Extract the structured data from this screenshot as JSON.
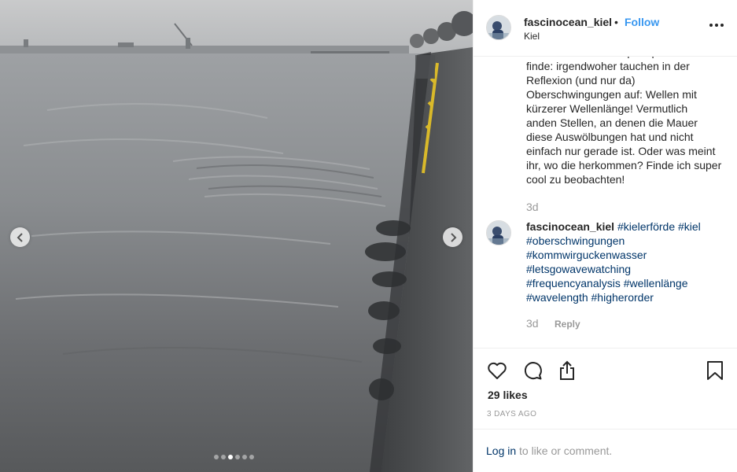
{
  "post": {
    "username": "fascinocean_kiel",
    "separator": "•",
    "follow_label": "Follow",
    "location": "Kiel"
  },
  "carousel": {
    "slide_count": 6,
    "active_index": 2
  },
  "caption": {
    "lines": [
      "wird. Und was ich super spannend",
      "finde: irgendwoher tauchen in der",
      "Reflexion (und nur da)",
      "Oberschwingungen auf: Wellen mit",
      "kürzerer Wellenlänge! Vermutlich",
      "anden Stellen, an denen die Mauer",
      "diese Auswölbungen hat und nicht",
      "einfach nur gerade ist. Oder was meint",
      "ihr, wo die herkommen? Finde ich super",
      "cool zu beobachten!"
    ],
    "age": "3d"
  },
  "comment": {
    "username": "fascinocean_kiel",
    "hashtags": [
      "#kielerförde",
      "#kiel",
      "#oberschwingungen",
      "#kommwirguckenwasser",
      "#letsgowavewatching",
      "#frequencyanalysis",
      "#wellenlänge",
      "#wavelength",
      "#higherorder"
    ],
    "age": "3d",
    "reply_label": "Reply"
  },
  "stats": {
    "likes": "29 likes",
    "time": "3 DAYS AGO"
  },
  "footer": {
    "login_label": "Log in",
    "login_rest": "to like or comment."
  },
  "icons": [
    "heart-icon",
    "comment-icon",
    "share-icon",
    "bookmark-icon",
    "more-options-icon",
    "chevron-left-icon",
    "chevron-right-icon"
  ]
}
